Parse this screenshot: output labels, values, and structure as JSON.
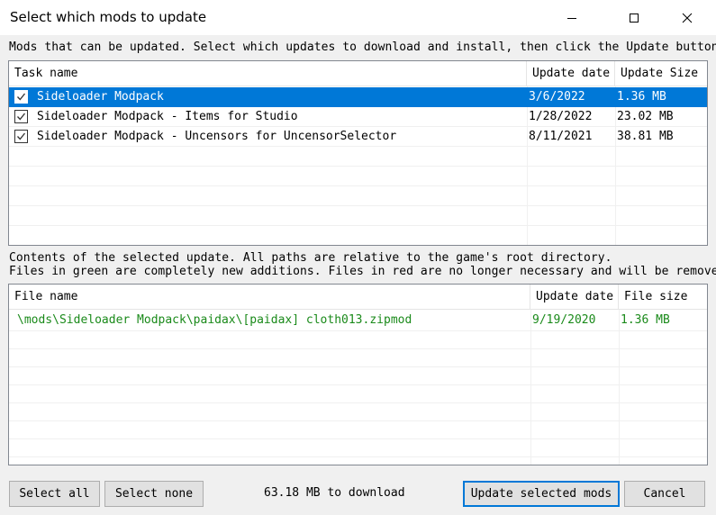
{
  "window": {
    "title": "Select which mods to update"
  },
  "updates_section": {
    "description": "Mods that can be updated. Select which updates to download and install, then click the Update button below.",
    "columns": [
      "Task name",
      "Update date",
      "Update Size"
    ],
    "rows": [
      {
        "name": "Sideloader Modpack",
        "date": "3/6/2022",
        "size": "1.36 MB",
        "checked": true,
        "selected": true
      },
      {
        "name": "Sideloader Modpack - Items for Studio",
        "date": "1/28/2022",
        "size": "23.02 MB",
        "checked": true,
        "selected": false
      },
      {
        "name": "Sideloader Modpack - Uncensors for UncensorSelector",
        "date": "8/11/2021",
        "size": "38.81 MB",
        "checked": true,
        "selected": false
      }
    ]
  },
  "contents_section": {
    "description_line1": "Contents of the selected update. All paths are relative to the game's root directory.",
    "description_line2": "Files in green are completely new additions. Files in red are no longer necessary and will be removed.",
    "columns": [
      "File name",
      "Update date",
      "File size"
    ],
    "rows": [
      {
        "name": "\\mods\\Sideloader Modpack\\paidax\\[paidax] cloth013.zipmod",
        "date": "9/19/2020",
        "size": "1.36 MB",
        "status": "new"
      }
    ]
  },
  "footer": {
    "select_all_label": "Select all",
    "select_none_label": "Select none",
    "download_size": "63.18 MB to download",
    "update_label": "Update selected mods",
    "cancel_label": "Cancel"
  },
  "colors": {
    "selection": "#0078d7",
    "new_file": "#1a8a1a"
  }
}
